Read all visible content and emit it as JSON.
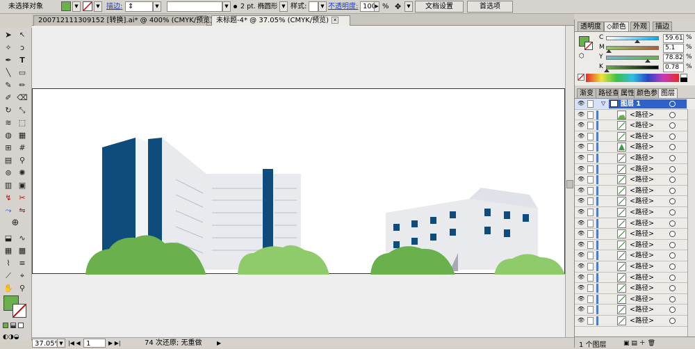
{
  "control_bar": {
    "selection_status": "未选择对象",
    "fill_color": "#6ab04c",
    "stroke_label": "描边:",
    "brush_label": "2 pt. 椭圆形",
    "style_label": "样式:",
    "opacity_label": "不透明度:",
    "opacity_value": "100",
    "opacity_unit": "%",
    "doc_setup_button": "文档设置",
    "prefs_button": "首选项"
  },
  "doc_tabs": [
    {
      "label": "200712111309152 [转换].ai* @ 400% (CMYK/预览)",
      "active": false
    },
    {
      "label": "未标题-4* @ 37.05% (CMYK/预览)",
      "active": true
    }
  ],
  "status_bar": {
    "zoom": "37.05%",
    "page": "1",
    "message": "74 次还原; 无重做"
  },
  "color_panel": {
    "tabs": [
      "透明度",
      "颜色",
      "外观",
      "描边"
    ],
    "active_tab": "颜色",
    "channels": [
      {
        "label": "C",
        "value": "59.61",
        "unit": "%",
        "level": 0.596
      },
      {
        "label": "M",
        "value": "5.1",
        "unit": "%",
        "level": 0.051
      },
      {
        "label": "Y",
        "value": "78.82",
        "unit": "%",
        "level": 0.788
      },
      {
        "label": "K",
        "value": "0.78",
        "unit": "%",
        "level": 0.008
      }
    ]
  },
  "layers_panel": {
    "tabs": [
      "渐变",
      "路径查",
      "属性",
      "颜色参",
      "图层"
    ],
    "active_tab": "图层",
    "layer_name": "图层 1",
    "path_label": "<路径>",
    "path_count": 20,
    "footer": "1 个图层"
  },
  "colors": {
    "navy": "#0d4c7c",
    "light_building": "#e8eaee",
    "green": "#6ab04c",
    "light_green": "#8fcb6a"
  }
}
